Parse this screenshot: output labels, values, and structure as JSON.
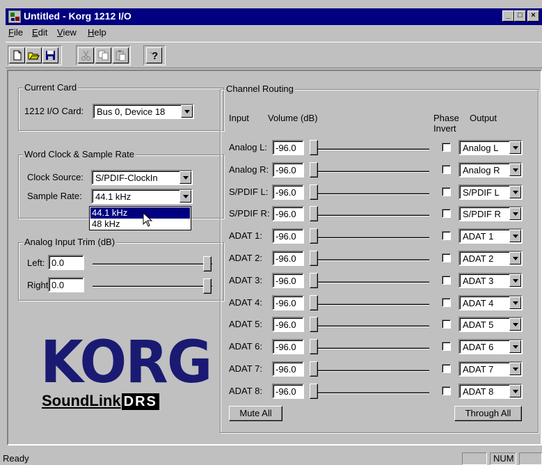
{
  "window": {
    "title": "Untitled - Korg 1212 I/O"
  },
  "menu": [
    {
      "label": "File",
      "mnemonic": "F",
      "rest": "ile"
    },
    {
      "label": "Edit",
      "mnemonic": "E",
      "rest": "dit"
    },
    {
      "label": "View",
      "mnemonic": "V",
      "rest": "iew"
    },
    {
      "label": "Help",
      "mnemonic": "H",
      "rest": "elp"
    }
  ],
  "toolbar": [
    "new-icon",
    "open-icon",
    "save-icon",
    "cut-icon",
    "copy-icon",
    "paste-icon",
    "help-icon"
  ],
  "current_card": {
    "legend": "Current Card",
    "label": "1212 I/O Card:",
    "value": "Bus 0, Device 18"
  },
  "clock": {
    "legend": "Word Clock & Sample Rate",
    "source_label": "Clock Source:",
    "source_value": "S/PDIF-ClockIn",
    "rate_label": "Sample Rate:",
    "rate_value": "44.1 kHz",
    "rate_options": [
      "44.1 kHz",
      "48 kHz"
    ],
    "rate_selected_index": 0
  },
  "trim": {
    "legend": "Analog Input Trim (dB)",
    "left_label": "Left:",
    "left_value": "0.0",
    "right_label": "Right:",
    "right_value": "0.0"
  },
  "logo": {
    "main": "KORG",
    "sub": "SoundLink",
    "badge": "DRS"
  },
  "routing": {
    "legend": "Channel Routing",
    "col_input": "Input",
    "col_volume": "Volume (dB)",
    "col_phase_1": "Phase",
    "col_phase_2": "Invert",
    "col_output": "Output",
    "channels": [
      {
        "input": "Analog L:",
        "volume": "-96.0",
        "invert": false,
        "output": "Analog L"
      },
      {
        "input": "Analog R:",
        "volume": "-96.0",
        "invert": false,
        "output": "Analog R"
      },
      {
        "input": "S/PDIF L:",
        "volume": "-96.0",
        "invert": false,
        "output": "S/PDIF L"
      },
      {
        "input": "S/PDIF R:",
        "volume": "-96.0",
        "invert": false,
        "output": "S/PDIF R"
      },
      {
        "input": "ADAT 1:",
        "volume": "-96.0",
        "invert": false,
        "output": "ADAT 1"
      },
      {
        "input": "ADAT 2:",
        "volume": "-96.0",
        "invert": false,
        "output": "ADAT 2"
      },
      {
        "input": "ADAT 3:",
        "volume": "-96.0",
        "invert": false,
        "output": "ADAT 3"
      },
      {
        "input": "ADAT 4:",
        "volume": "-96.0",
        "invert": false,
        "output": "ADAT 4"
      },
      {
        "input": "ADAT 5:",
        "volume": "-96.0",
        "invert": false,
        "output": "ADAT 5"
      },
      {
        "input": "ADAT 6:",
        "volume": "-96.0",
        "invert": false,
        "output": "ADAT 6"
      },
      {
        "input": "ADAT 7:",
        "volume": "-96.0",
        "invert": false,
        "output": "ADAT 7"
      },
      {
        "input": "ADAT 8:",
        "volume": "-96.0",
        "invert": false,
        "output": "ADAT 8"
      }
    ],
    "mute_label": "Mute All",
    "through_label": "Through All"
  },
  "status": {
    "text": "Ready",
    "num": "NUM"
  }
}
